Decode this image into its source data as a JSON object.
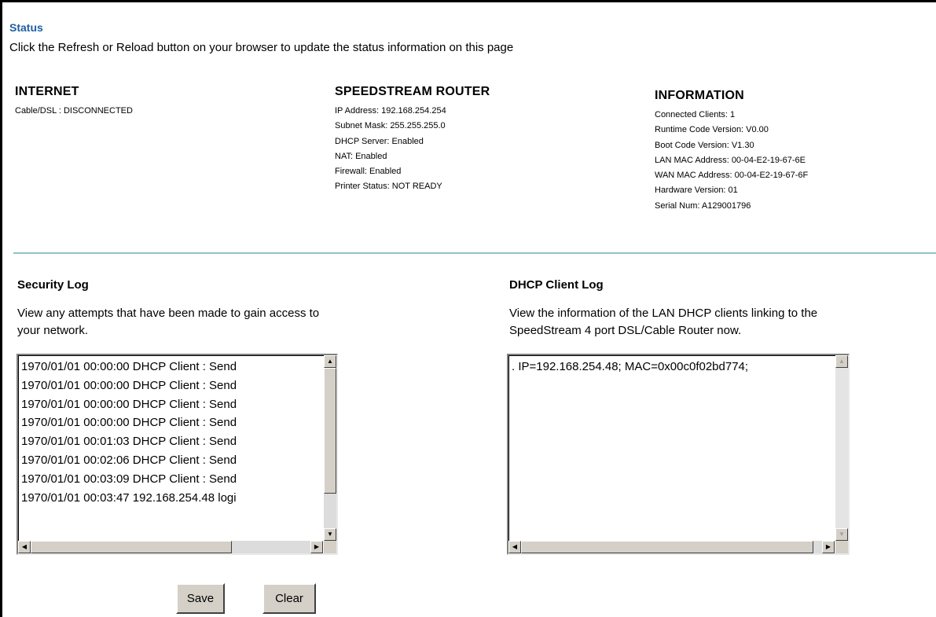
{
  "header": {
    "title": "Status",
    "description": "Click the Refresh or Reload button on your browser to update the status information on this page"
  },
  "internet": {
    "heading": "INTERNET",
    "lines": [
      "Cable/DSL : DISCONNECTED"
    ]
  },
  "router": {
    "heading": "SPEEDSTREAM ROUTER",
    "lines": [
      "IP Address:  192.168.254.254",
      "Subnet Mask:  255.255.255.0",
      "DHCP Server:  Enabled",
      "NAT:  Enabled",
      "Firewall:  Enabled",
      "Printer Status: NOT READY"
    ]
  },
  "information": {
    "heading": "INFORMATION",
    "lines": [
      "Connected Clients:  1",
      "Runtime Code Version:  V0.00",
      "Boot Code Version:  V1.30",
      "LAN MAC Address:  00-04-E2-19-67-6E",
      "WAN MAC Address:  00-04-E2-19-67-6F",
      "Hardware Version:  01",
      "Serial Num:  A129001796"
    ]
  },
  "security_log": {
    "heading": "Security Log",
    "description_line1": "View any attempts that have been made to gain access to",
    "description_line2": "your network.",
    "entries": [
      "1970/01/01 00:00:00  DHCP Client : Send",
      "1970/01/01 00:00:00  DHCP Client : Send",
      "1970/01/01 00:00:00  DHCP Client : Send",
      "1970/01/01 00:00:00  DHCP Client : Send",
      "1970/01/01 00:01:03  DHCP Client : Send",
      "1970/01/01 00:02:06  DHCP Client : Send",
      "1970/01/01 00:03:09  DHCP Client : Send",
      "1970/01/01 00:03:47  192.168.254.48 logi"
    ]
  },
  "dhcp_log": {
    "heading": "DHCP Client Log",
    "description_line1": "View the information of the LAN DHCP clients linking to the",
    "description_line2": "SpeedStream 4 port DSL/Cable Router now.",
    "entries": [
      ". IP=192.168.254.48; MAC=0x00c0f02bd774;"
    ]
  },
  "buttons": {
    "save": "Save",
    "clear": "Clear"
  },
  "scroll_glyphs": {
    "up": "▲",
    "down": "▼",
    "left": "◀",
    "right": "▶"
  }
}
